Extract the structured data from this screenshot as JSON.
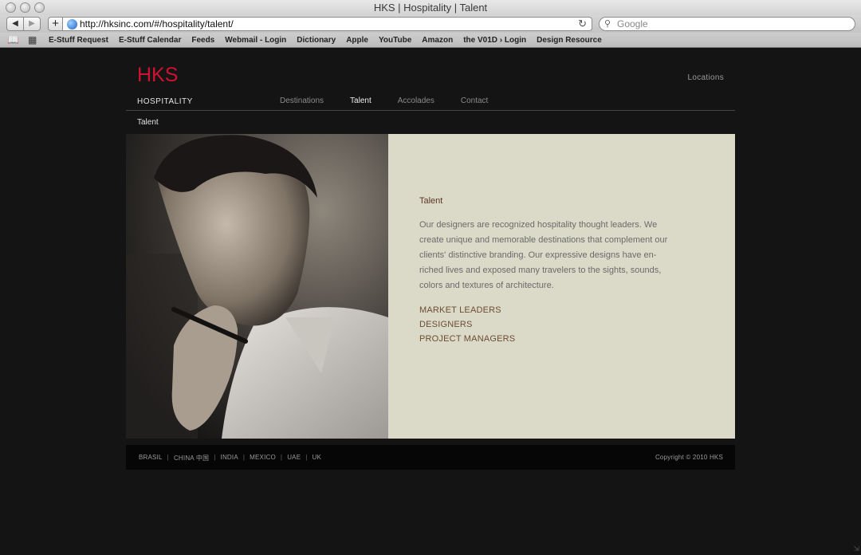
{
  "window": {
    "title": "HKS | Hospitality | Talent"
  },
  "toolbar": {
    "back_label": "◀",
    "forward_label": "▶",
    "add_label": "+",
    "url": "http://hksinc.com/#/hospitality/talent/",
    "reload_label": "↻",
    "search_placeholder": "Google"
  },
  "bookmarks": [
    "E-Stuff Request",
    "E-Stuff Calendar",
    "Feeds",
    "Webmail - Login",
    "Dictionary",
    "Apple",
    "YouTube",
    "Amazon",
    "the V01D › Login",
    "Design Resource"
  ],
  "site": {
    "logo": "HKS",
    "locations_label": "Locations",
    "section_label": "HOSPITALITY",
    "nav": [
      "Destinations",
      "Talent",
      "Accolades",
      "Contact"
    ],
    "active_nav": "Talent",
    "breadcrumb": "Talent"
  },
  "content": {
    "title": "Talent",
    "body": "Our designers are recognized hospitality thought leaders. We create unique and memorable destinations that complement our clients' distinctive branding. Our expressive designs have en-riched lives and exposed many travelers to the sights, sounds, colors and textures of architecture.",
    "links": [
      "MARKET LEADERS",
      "DESIGNERS",
      "PROJECT MANAGERS"
    ]
  },
  "footer": {
    "countries": [
      "BRASIL",
      "CHINA 中国",
      "INDIA",
      "MEXICO",
      "UAE",
      "UK"
    ],
    "separator": "|",
    "copyright": "Copyright © 2010 HKS"
  },
  "colors": {
    "brand_red": "#cf1232",
    "panel_bg": "#dbdac8",
    "page_bg": "#141414"
  }
}
